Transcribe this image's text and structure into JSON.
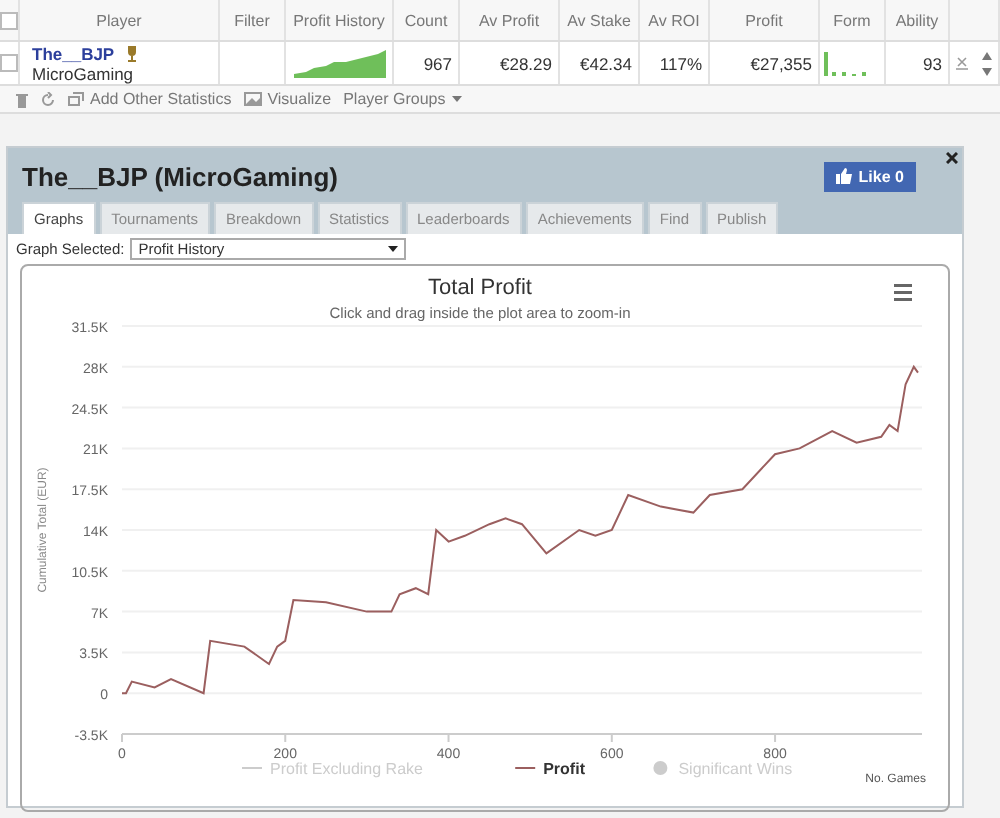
{
  "table": {
    "all_checked": false,
    "columns": [
      "Player",
      "Filter",
      "Profit History",
      "Count",
      "Av Profit",
      "Av Stake",
      "Av ROI",
      "Profit",
      "Form",
      "Ability"
    ],
    "rows": [
      {
        "checked": false,
        "player": "The__BJP",
        "network": "MicroGaming",
        "count": "967",
        "av_profit": "€28.29",
        "av_stake": "€42.34",
        "av_roi": "117%",
        "profit": "€27,355",
        "ability": "93"
      }
    ]
  },
  "toolbar": {
    "add_statistics": "Add Other Statistics",
    "visualize": "Visualize",
    "player_groups": "Player Groups"
  },
  "panel": {
    "title": "The__BJP (MicroGaming)",
    "like": {
      "label": "Like",
      "count": "0"
    },
    "tabs": [
      {
        "label": "Graphs",
        "selected": true
      },
      {
        "label": "Tournaments",
        "selected": false
      },
      {
        "label": "Breakdown",
        "selected": false
      },
      {
        "label": "Statistics",
        "selected": false
      },
      {
        "label": "Leaderboards",
        "selected": false
      },
      {
        "label": "Achievements",
        "selected": false
      },
      {
        "label": "Find",
        "selected": false
      },
      {
        "label": "Publish",
        "selected": false
      }
    ],
    "graph_selector": {
      "label": "Graph Selected:",
      "value": "Profit History"
    },
    "chart": {
      "subtitle": "Click and drag inside the plot area to zoom-in",
      "legend": [
        {
          "label": "Profit Excluding Rake",
          "kind": "line",
          "visible": false
        },
        {
          "kind": "series",
          "visible": true
        },
        {
          "label": "Significant Wins",
          "kind": "marker",
          "visible": false
        }
      ],
      "chart_data": {
        "type": "line",
        "title": "Total Profit",
        "xlabel": "No. Games",
        "ylabel": "Cumulative Total (EUR)",
        "x": [
          0,
          5,
          12,
          40,
          60,
          100,
          108,
          150,
          180,
          190,
          200,
          210,
          250,
          300,
          330,
          340,
          360,
          375,
          385,
          400,
          420,
          450,
          470,
          490,
          520,
          560,
          580,
          600,
          620,
          660,
          700,
          720,
          760,
          800,
          830,
          870,
          900,
          930,
          940,
          950,
          960,
          970,
          975
        ],
        "series": [
          {
            "name": "Profit",
            "color": "#9b5f5f",
            "values": [
              0,
              0,
              1000,
              500,
              1200,
              0,
              4500,
              4000,
              2500,
              4000,
              4500,
              8000,
              7800,
              7000,
              7000,
              8500,
              9000,
              8500,
              14000,
              13000,
              13500,
              14500,
              15000,
              14500,
              12000,
              14000,
              13500,
              14000,
              17000,
              16000,
              15500,
              17000,
              17500,
              20500,
              21000,
              22500,
              21500,
              22000,
              23000,
              22500,
              26500,
              28000,
              27500
            ]
          }
        ],
        "grid": true,
        "xlim": [
          0,
          980
        ],
        "ylim": [
          -3500,
          31500
        ],
        "xticks": [
          0,
          200,
          400,
          600,
          800
        ],
        "yticks": [
          {
            "value": -3500,
            "label": "-3.5K"
          },
          {
            "value": 0,
            "label": "0"
          },
          {
            "value": 3500,
            "label": "3.5K"
          },
          {
            "value": 7000,
            "label": "7K"
          },
          {
            "value": 10500,
            "label": "10.5K"
          },
          {
            "value": 14000,
            "label": "14K"
          },
          {
            "value": 17500,
            "label": "17.5K"
          },
          {
            "value": 21000,
            "label": "21K"
          },
          {
            "value": 24500,
            "label": "24.5K"
          },
          {
            "value": 28000,
            "label": "28K"
          },
          {
            "value": 31500,
            "label": "31.5K"
          }
        ]
      }
    }
  }
}
